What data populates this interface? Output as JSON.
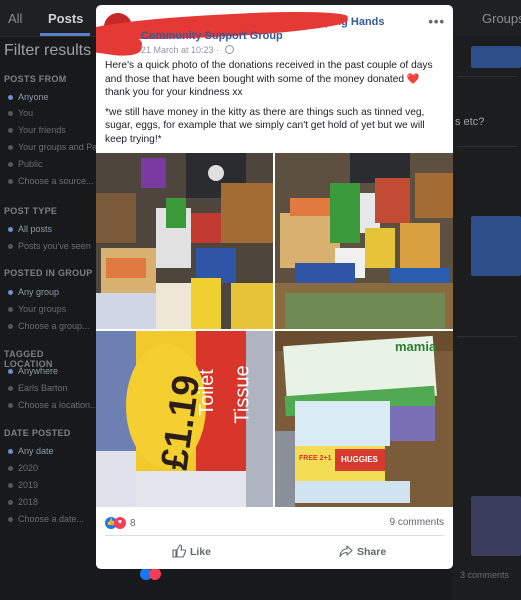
{
  "background": {
    "tabs": [
      "All",
      "Posts",
      "Groups"
    ],
    "filters_title": "Filter results",
    "sections": [
      {
        "heading": "POSTS FROM",
        "options": [
          "Anyone",
          "You",
          "Your friends",
          "Your groups and Pages",
          "Public",
          "Choose a source..."
        ]
      },
      {
        "heading": "POST TYPE",
        "options": [
          "All posts",
          "Posts you've seen"
        ]
      },
      {
        "heading": "POSTED IN GROUP",
        "options": [
          "Any group",
          "Your groups",
          "Choose a group..."
        ]
      },
      {
        "heading": "TAGGED LOCATION",
        "options": [
          "Anywhere",
          "Earls Barton",
          "Choose a location..."
        ]
      },
      {
        "heading": "DATE POSTED",
        "options": [
          "Any date",
          "2020",
          "2019",
          "2018",
          "Choose a date..."
        ]
      }
    ],
    "right_snippet": "s etc?",
    "footer_comments": "3 comments"
  },
  "post": {
    "author_suffix": "gh Helping Hands",
    "group": "Community Support Group",
    "timestamp": "21 March at 10:23 · ",
    "more": "•••",
    "paragraph1": "Here's a quick photo of the donations received in the past couple of days and those that have been bought with some of the money donated ",
    "paragraph1_end": " thank you for your kindness xx",
    "heart": "❤️",
    "paragraph2": "*we still have money in the kitty as there are things such as tinned veg, sugar, eggs, for example that we simply can't get hold of yet but we will keep trying!*",
    "photo_texts": {
      "price": "£1.19",
      "toilet": "Toilet",
      "tissue": "Tissue",
      "mamia": "mamia",
      "huggies": "HUGGIES",
      "free": "FREE 2+1"
    },
    "reaction_count": "8",
    "comments": "9 comments",
    "like": "Like",
    "share": "Share"
  }
}
